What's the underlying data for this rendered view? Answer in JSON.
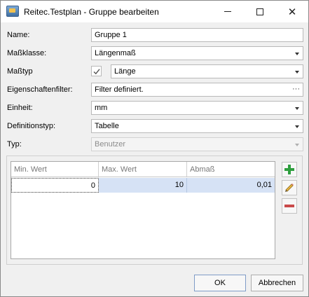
{
  "window": {
    "title": "Reitec.Testplan - Gruppe bearbeiten",
    "app_icon": "reitec-app-icon",
    "controls": {
      "minimize": "minimize-icon",
      "maximize": "maximize-icon",
      "close": "✕"
    }
  },
  "form": {
    "name": {
      "label": "Name:",
      "value": "Gruppe 1"
    },
    "massklasse": {
      "label": "Maßklasse:",
      "value": "Längenmaß"
    },
    "masstyp": {
      "label": "Maßtyp",
      "checked": true,
      "value": "Länge"
    },
    "eigenschaftenfilter": {
      "label": "Eigenschaftenfilter:",
      "value": "Filter definiert.",
      "button": "···"
    },
    "einheit": {
      "label": "Einheit:",
      "value": "mm"
    },
    "definitionstyp": {
      "label": "Definitionstyp:",
      "value": "Tabelle"
    },
    "typ": {
      "label": "Typ:",
      "value": "Benutzer",
      "disabled": true
    }
  },
  "table": {
    "columns": [
      "Min. Wert",
      "Max. Wert",
      "Abmaß"
    ],
    "rows": [
      [
        "0",
        "10",
        "0,01"
      ]
    ]
  },
  "side_buttons": {
    "add": "plus-icon",
    "edit": "pencil-icon",
    "remove": "minus-icon"
  },
  "colors": {
    "add": "#2e9e3e",
    "remove": "#c94a4a",
    "selected_row": "#d6e2f5"
  },
  "buttons": {
    "ok": "OK",
    "cancel": "Abbrechen"
  }
}
